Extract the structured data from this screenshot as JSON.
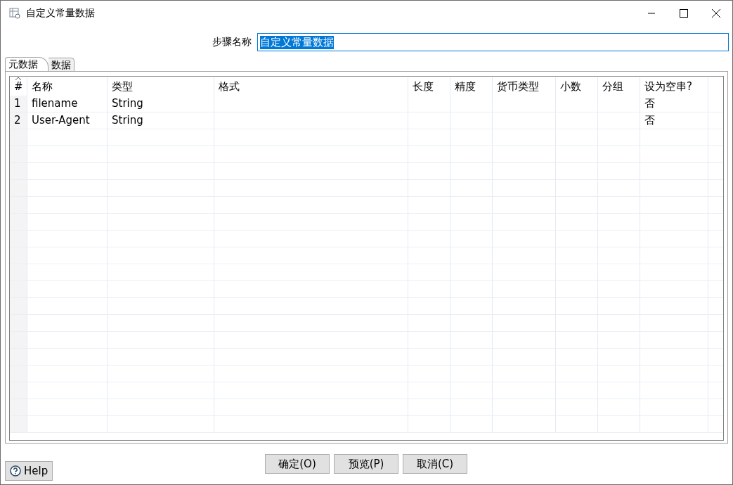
{
  "window": {
    "title": "自定义常量数据"
  },
  "step_name": {
    "label": "步骤名称",
    "value": "自定义常量数据",
    "selected_text": true
  },
  "tabs": [
    {
      "label": "元数据",
      "selected": true
    },
    {
      "label": "数据",
      "selected": false
    }
  ],
  "table": {
    "columns": [
      "#",
      "名称",
      "类型",
      "格式",
      "长度",
      "精度",
      "货币类型",
      "小数",
      "分组",
      "设为空串?"
    ],
    "rows": [
      [
        "1",
        "filename",
        "String",
        "",
        "",
        "",
        "",
        "",
        "",
        "否"
      ],
      [
        "2",
        "User-Agent",
        "String",
        "",
        "",
        "",
        "",
        "",
        "",
        "否"
      ]
    ]
  },
  "buttons": [
    "确定(O)",
    "预览(P)",
    "取消(C)"
  ],
  "help_button": "Help"
}
